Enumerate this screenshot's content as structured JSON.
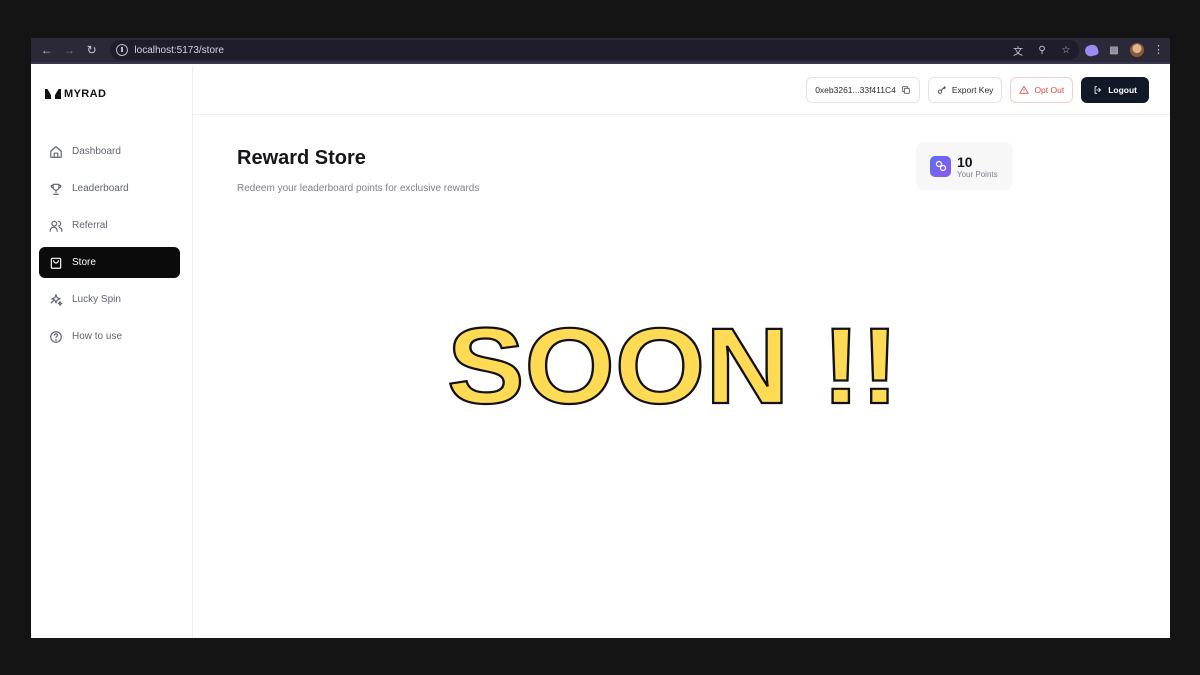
{
  "browser": {
    "url": "localhost:5173/store"
  },
  "sidebar": {
    "logo": "MYRAD",
    "items": [
      {
        "label": "Dashboard",
        "icon": "home-icon"
      },
      {
        "label": "Leaderboard",
        "icon": "trophy-icon"
      },
      {
        "label": "Referral",
        "icon": "users-icon"
      },
      {
        "label": "Store",
        "icon": "shopping-bag-icon",
        "active": true
      },
      {
        "label": "Lucky Spin",
        "icon": "sparkles-icon"
      },
      {
        "label": "How to use",
        "icon": "help-circle-icon"
      }
    ]
  },
  "header": {
    "wallet": "0xeb3261...33f411C4",
    "export_label": "Export Key",
    "optout_label": "Opt Out",
    "logout_label": "Logout"
  },
  "main": {
    "title": "Reward Store",
    "subtitle": "Redeem your leaderboard points for exclusive rewards",
    "points_value": "10",
    "points_label": "Your Points",
    "banner": "SOON !!"
  },
  "colors": {
    "accent_dark": "#111827",
    "warning": "#e04848",
    "banner_fill": "#ffdb55",
    "points_icon": "#6c63f0"
  }
}
